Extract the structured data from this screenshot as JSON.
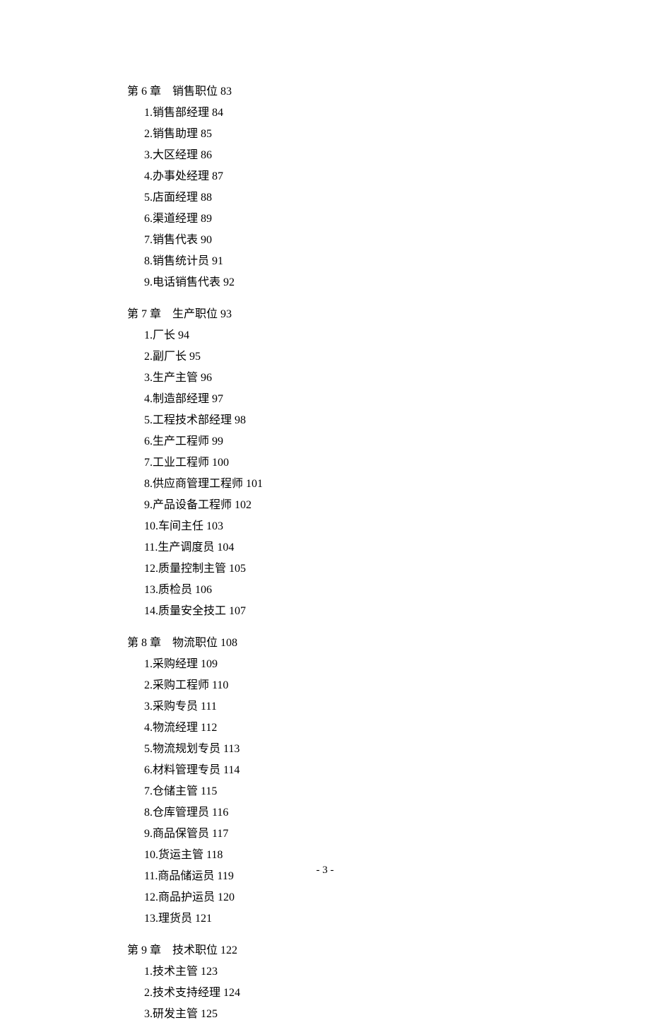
{
  "chapters": [
    {
      "title": "第 6 章　销售职位 83",
      "items": [
        "1.销售部经理 84",
        "2.销售助理 85",
        "3.大区经理 86",
        "4.办事处经理 87",
        "5.店面经理 88",
        "6.渠道经理 89",
        "7.销售代表 90",
        "8.销售统计员 91",
        "9.电话销售代表 92"
      ]
    },
    {
      "title": "第 7 章　生产职位 93",
      "items": [
        "1.厂长 94",
        "2.副厂长 95",
        "3.生产主管 96",
        "4.制造部经理 97",
        "5.工程技术部经理 98",
        "6.生产工程师 99",
        "7.工业工程师 100",
        "8.供应商管理工程师 101",
        "9.产品设备工程师 102",
        "10.车间主任 103",
        "11.生产调度员 104",
        "12.质量控制主管 105",
        "13.质检员 106",
        "14.质量安全技工 107"
      ]
    },
    {
      "title": "第 8 章　物流职位 108",
      "items": [
        "1.采购经理 109",
        "2.采购工程师 110",
        "3.采购专员 111",
        "4.物流经理 112",
        "5.物流规划专员 113",
        "6.材料管理专员 114",
        "7.仓储主管 115",
        "8.仓库管理员 116",
        "9.商品保管员 117",
        "10.货运主管 118",
        "11.商品储运员 119",
        "12.商品护运员 120",
        "13.理货员 121"
      ]
    },
    {
      "title": "第 9 章　技术职位 122",
      "items": [
        "1.技术主管 123",
        "2.技术支持经理 124",
        "3.研发主管 125"
      ]
    }
  ],
  "pageNumber": "- 3 -"
}
